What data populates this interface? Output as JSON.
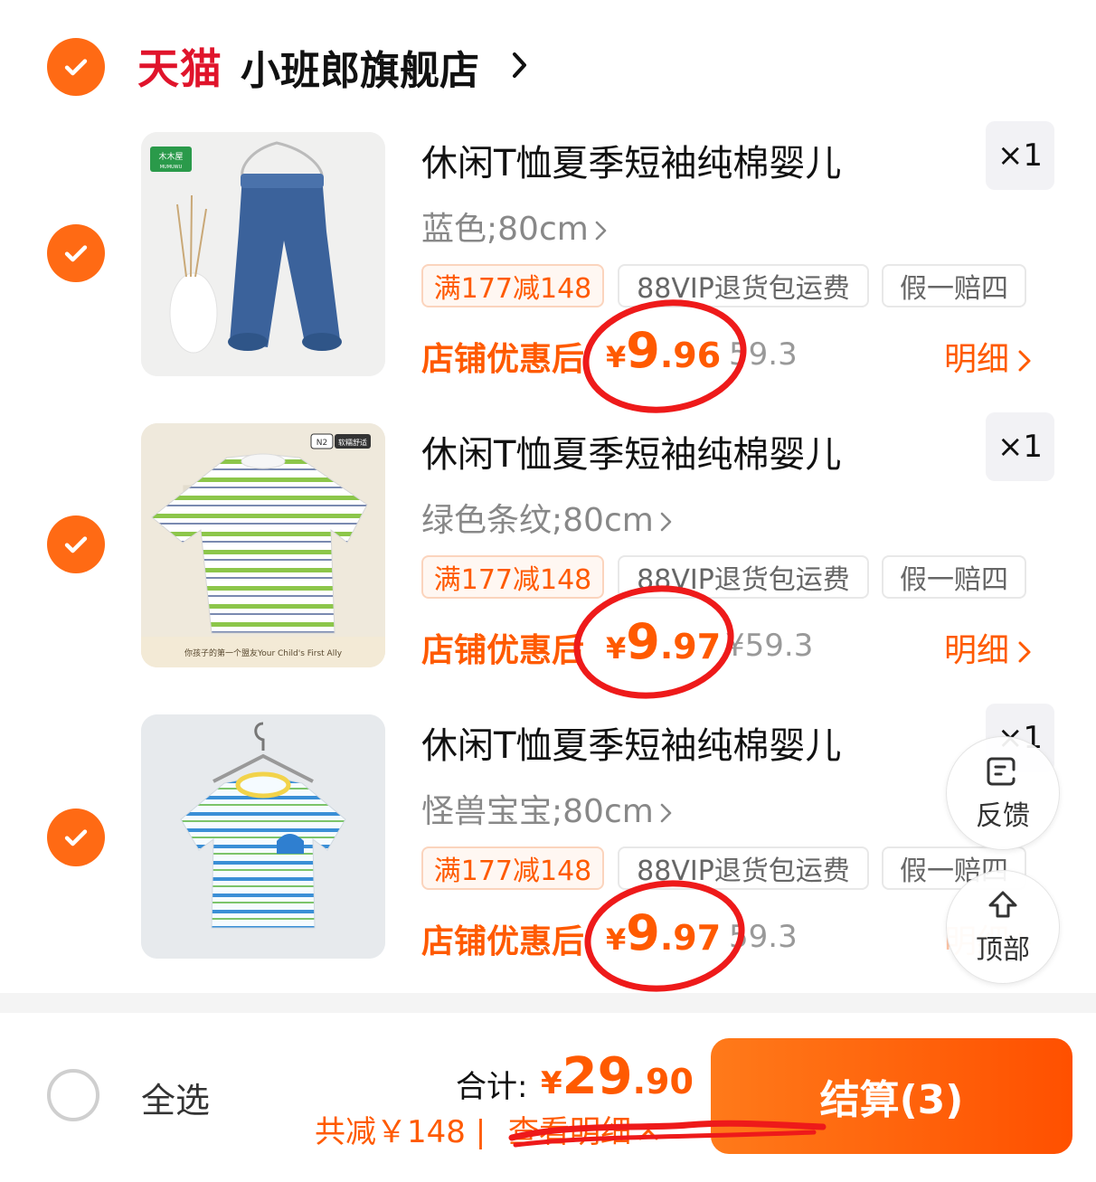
{
  "store": {
    "brand": "天猫",
    "name": "小班郎旗舰店"
  },
  "items": [
    {
      "title": "休闲T恤夏季短袖纯棉婴儿",
      "spec": "蓝色;80cm",
      "quantity": "×1",
      "tags": [
        "满177减148",
        "88VIP退货包运费",
        "假一赔四"
      ],
      "price_label": "店铺优惠后",
      "price_yen": "¥",
      "price_int": "9",
      "price_dec": ".96",
      "original_price": "59.3",
      "detail_label": "明细",
      "image_brand": "木木屋",
      "image_brand_sub": "MUMUWU"
    },
    {
      "title": "休闲T恤夏季短袖纯棉婴儿",
      "spec": "绿色条纹;80cm",
      "quantity": "×1",
      "tags": [
        "满177减148",
        "88VIP退货包运费",
        "假一赔四"
      ],
      "price_label": "店铺优惠后",
      "price_yen": "¥",
      "price_int": "9",
      "price_dec": ".97",
      "original_price": "¥59.3",
      "detail_label": "明细",
      "image_badge_1": "N2",
      "image_badge_2": "软糯舒适",
      "image_caption": "你孩子的第一个盟友Your Child's First Ally"
    },
    {
      "title": "休闲T恤夏季短袖纯棉婴儿",
      "spec": "怪兽宝宝;80cm",
      "quantity": "×1",
      "tags": [
        "满177减148",
        "88VIP退货包运费",
        "假一赔四"
      ],
      "price_label": "店铺优惠后",
      "price_yen": "¥",
      "price_int": "9",
      "price_dec": ".97",
      "original_price": "59.3",
      "detail_label": "明细"
    }
  ],
  "floating": {
    "feedback": "反馈",
    "top": "顶部"
  },
  "footer": {
    "select_all": "全选",
    "total_label": "合计:",
    "total_yen": "¥",
    "total_int": "29",
    "total_dec": ".90",
    "saving": "共减￥148 |",
    "view_detail": "查看明细",
    "checkout": "结算(3)"
  },
  "colors": {
    "accent": "#ff5a00",
    "checkbox": "#ff6a14",
    "tmall": "#e0142b",
    "annotation": "#ee1a1a"
  }
}
